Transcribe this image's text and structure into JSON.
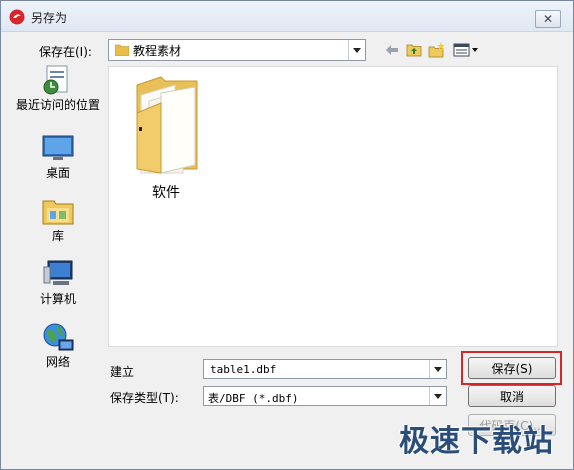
{
  "window": {
    "title": "另存为",
    "close_label": "✕"
  },
  "location": {
    "label": "保存在(I):",
    "value": "教程素材"
  },
  "places": [
    {
      "label": "最近访问的位置",
      "icon": "recent-places-icon"
    },
    {
      "label": "桌面",
      "icon": "desktop-icon"
    },
    {
      "label": "库",
      "icon": "libraries-icon"
    },
    {
      "label": "计算机",
      "icon": "computer-icon"
    },
    {
      "label": "网络",
      "icon": "network-icon"
    }
  ],
  "files": [
    {
      "name": "软件",
      "icon": "folder-icon"
    }
  ],
  "filename": {
    "label": "建立",
    "value": "table1.dbf"
  },
  "filetype": {
    "label": "保存类型(T):",
    "value": "表/DBF (*.dbf)"
  },
  "buttons": {
    "save": "保存(S)",
    "cancel": "取消",
    "code_page": "代码页(C)..."
  },
  "watermark": "极速下载站",
  "colors": {
    "highlight": "#d6262a",
    "folder": "#f2cc6b"
  }
}
